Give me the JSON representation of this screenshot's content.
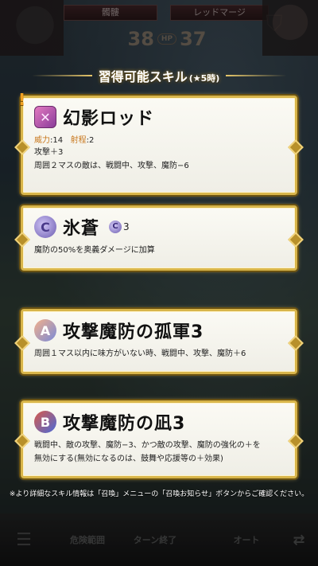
{
  "header": {
    "left_name": "髑髏",
    "right_name": "レッドマージ",
    "hp_left": "38",
    "hp_label": "HP",
    "hp_right": "37",
    "emblem_icon": "shield-icon"
  },
  "title": {
    "main": "習得可能スキル",
    "sub": "(★5時)"
  },
  "skills": [
    {
      "icon": "weapon-icon",
      "icon_glyph": "✕",
      "name": "幻影ロッド",
      "might_label": "威力",
      "might": ":14",
      "range_label": "射程",
      "range": ":2",
      "desc_1": "攻撃＋3",
      "desc_2": "周囲２マスの敵は、戦闘中、攻撃、魔防−6"
    },
    {
      "icon": "special-icon",
      "icon_glyph": "C",
      "name": "氷蒼",
      "cooldown_glyph": "C",
      "cooldown": "3",
      "desc_1": "魔防の50%を奥義ダメージに加算"
    },
    {
      "icon": "passive-a-icon",
      "icon_glyph": "A",
      "name": "攻撃魔防の孤軍3",
      "desc_1": "周囲１マス以内に味方がいない時、戦闘中、攻撃、魔防＋6"
    },
    {
      "icon": "passive-b-icon",
      "icon_glyph": "B",
      "name": "攻撃魔防の凪3",
      "desc_1": "戦闘中、敵の攻撃、魔防−3、かつ敵の攻撃、魔防の強化の＋を",
      "desc_2": "無効にする(無効になるのは、鼓舞や応援等の＋効果)"
    }
  ],
  "notice_mark": "!",
  "footnote": "※より詳細なスキル情報は「召喚」メニューの「召喚お知らせ」ボタンからご確認ください。",
  "bottom": {
    "menu_glyph": "☰",
    "danger": "危険範囲",
    "turn": "ターン終了",
    "auto": "オート",
    "swap_glyph": "⇄"
  }
}
